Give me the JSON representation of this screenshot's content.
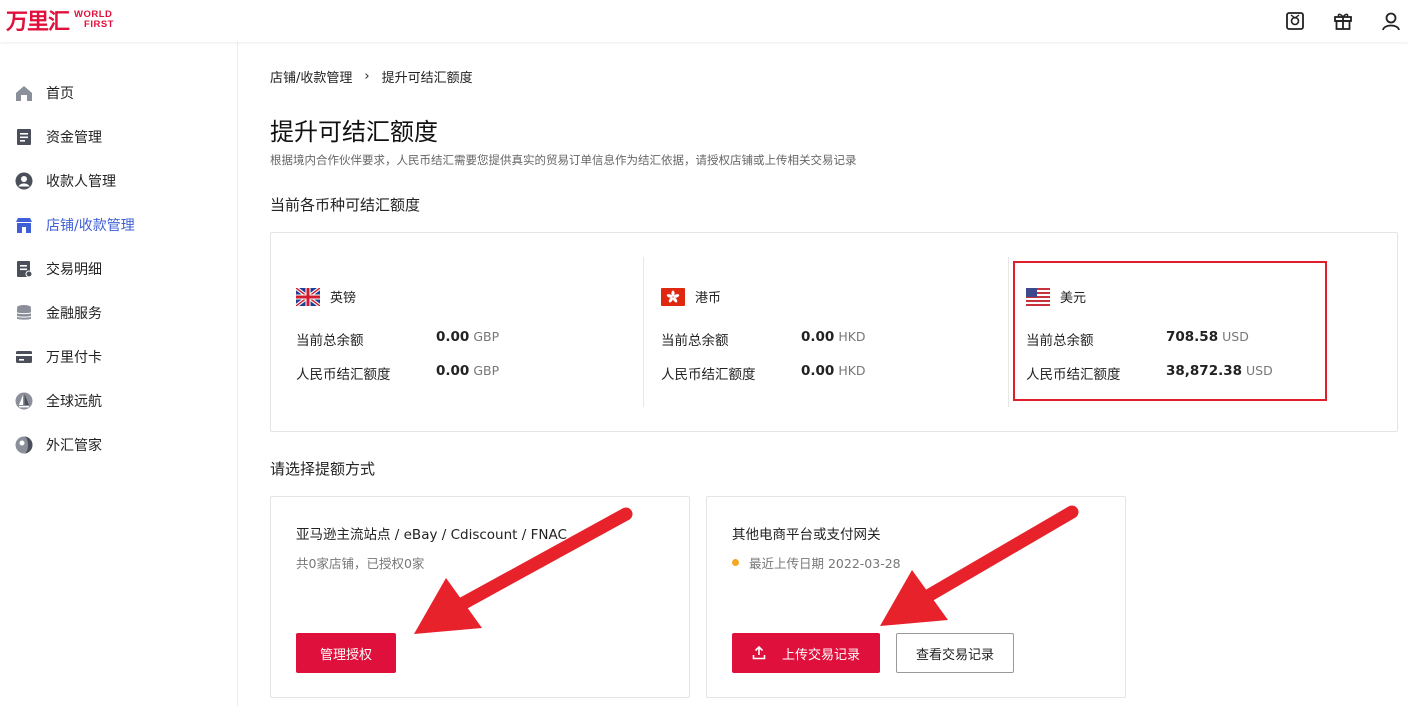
{
  "brand": {
    "name_cn": "万里汇",
    "name_en_line1": "WORLD",
    "name_en_line2": "FIRST",
    "accent": "#e0103c"
  },
  "topbar": {
    "icons": [
      "message-box-icon",
      "gift-icon",
      "user-icon"
    ]
  },
  "sidebar": {
    "items": [
      {
        "label": "首页",
        "icon": "home-icon"
      },
      {
        "label": "资金管理",
        "icon": "document-icon"
      },
      {
        "label": "收款人管理",
        "icon": "person-circle-icon"
      },
      {
        "label": "店铺/收款管理",
        "icon": "store-icon",
        "active": true
      },
      {
        "label": "交易明细",
        "icon": "list-doc-icon"
      },
      {
        "label": "金融服务",
        "icon": "database-icon"
      },
      {
        "label": "万里付卡",
        "icon": "card-icon"
      },
      {
        "label": "全球远航",
        "icon": "sail-icon"
      },
      {
        "label": "外汇管家",
        "icon": "globe-icon"
      }
    ]
  },
  "breadcrumb": {
    "parent": "店铺/收款管理",
    "separator": "›",
    "current": "提升可结汇额度"
  },
  "page": {
    "title": "提升可结汇额度",
    "description": "根据境内合作伙伴要求，人民币结汇需要您提供真实的贸易订单信息作为结汇依据，请授权店铺或上传相关交易记录"
  },
  "balances": {
    "section_title": "当前各币种可结汇额度",
    "balance_label": "当前总余额",
    "quota_label": "人民币结汇额度",
    "currencies": [
      {
        "name": "英镑",
        "flag": "uk-flag-icon",
        "balance": "0.00",
        "quota": "0.00",
        "unit": "GBP"
      },
      {
        "name": "港币",
        "flag": "hk-flag-icon",
        "balance": "0.00",
        "quota": "0.00",
        "unit": "HKD"
      },
      {
        "name": "美元",
        "flag": "us-flag-icon",
        "balance": "708.58",
        "quota": "38,872.38",
        "unit": "USD"
      }
    ],
    "highlight_color": "#e11e2b"
  },
  "methods": {
    "section_title": "请选择提额方式",
    "amazon": {
      "title": "亚马逊主流站点 / eBay / Cdiscount / FNAC",
      "subtitle": "共0家店铺，已授权0家",
      "button": "管理授权"
    },
    "other": {
      "title": "其他电商平台或支付网关",
      "subtitle": "最近上传日期 2022-03-28",
      "upload_button": "上传交易记录",
      "view_button": "查看交易记录"
    }
  }
}
